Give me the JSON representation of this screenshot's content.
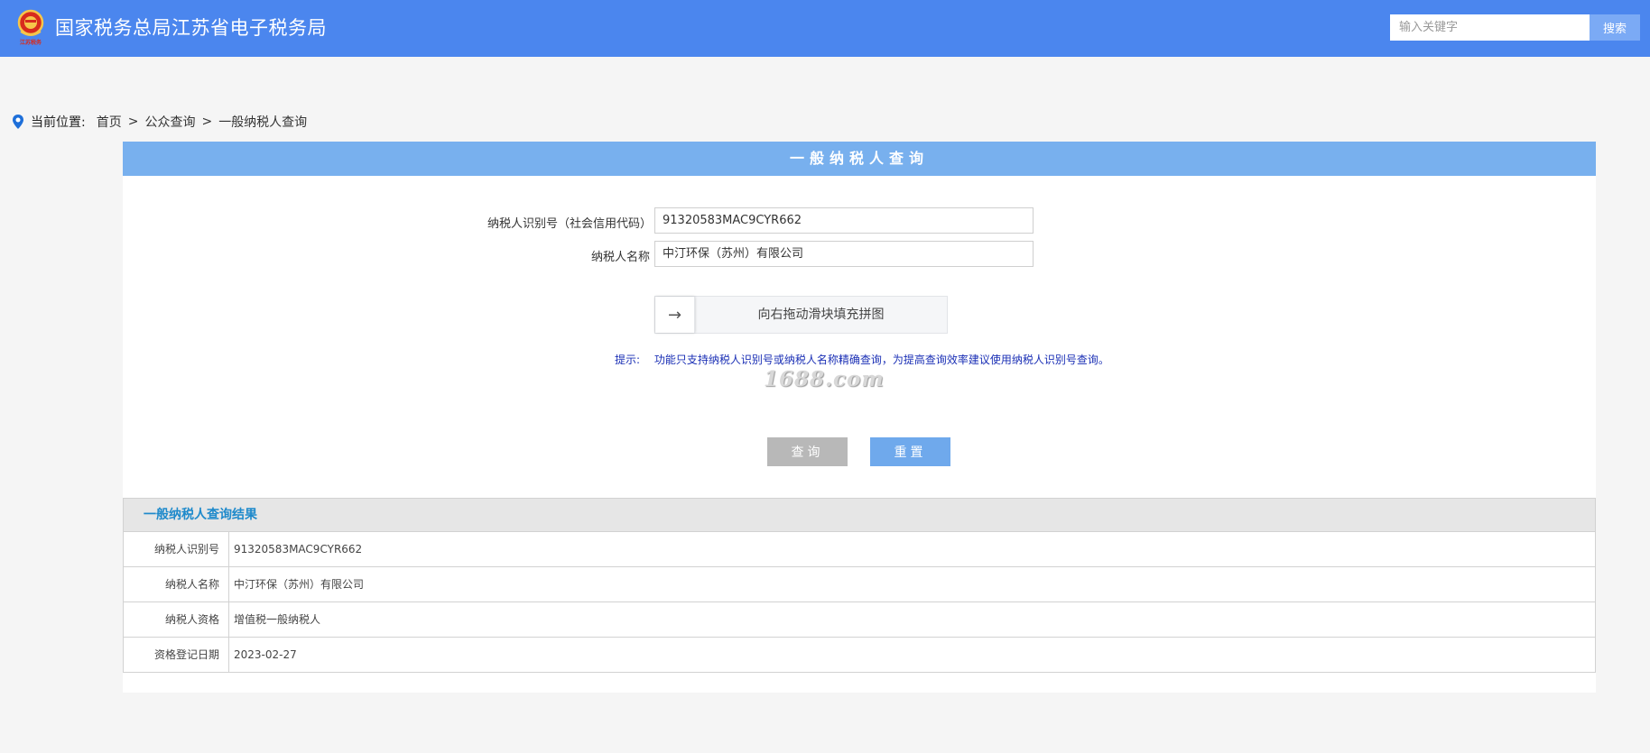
{
  "header": {
    "site_title": "国家税务总局江苏省电子税务局",
    "logo_caption": "江苏税务",
    "search_placeholder": "输入关键字",
    "search_button": "搜索"
  },
  "breadcrumb": {
    "label": "当前位置:",
    "items": [
      "首页",
      "公众查询",
      "一般纳税人查询"
    ],
    "separator": ">"
  },
  "panel": {
    "title": "一般纳税人查询"
  },
  "form": {
    "id_label": "纳税人识别号（社会信用代码）",
    "id_value": "91320583MAC9CYR662",
    "name_label": "纳税人名称",
    "name_value": "中汀环保（苏州）有限公司",
    "slider_text": "向右拖动滑块填充拼图",
    "slider_icon": "→",
    "hint_label": "提示:",
    "hint_text": "功能只支持纳税人识别号或纳税人名称精确查询，为提高查询效率建议使用纳税人识别号查询。",
    "watermark": "1688.com",
    "query_button": "查询",
    "reset_button": "重置"
  },
  "results": {
    "title": "一般纳税人查询结果",
    "rows": [
      {
        "key": "纳税人识别号",
        "value": "91320583MAC9CYR662"
      },
      {
        "key": "纳税人名称",
        "value": "中汀环保（苏州）有限公司"
      },
      {
        "key": "纳税人资格",
        "value": "增值税一般纳税人"
      },
      {
        "key": "资格登记日期",
        "value": "2023-02-27"
      }
    ]
  },
  "colors": {
    "header_bg": "#4b86ee",
    "panel_title_bg": "#78b0ee",
    "hint_text": "#1a2fb5",
    "results_title": "#1f8acb"
  }
}
